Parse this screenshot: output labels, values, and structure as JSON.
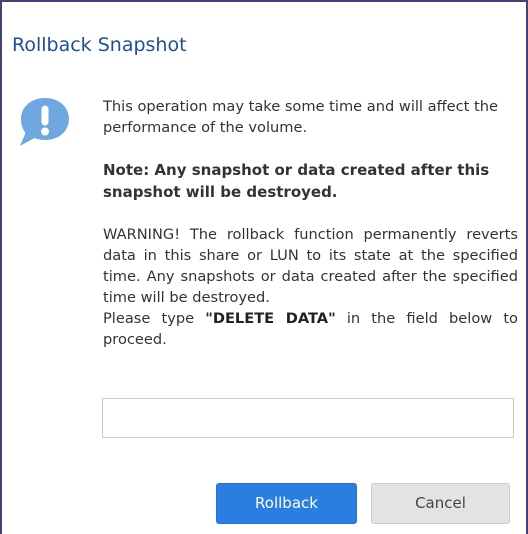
{
  "dialog": {
    "title": "Rollback Snapshot",
    "icon": "info-speech-bubble-icon",
    "message_performance": "This operation may take some time and will affect the performance of the volume.",
    "note": "Note: Any snapshot or data created after this snapshot will be destroyed.",
    "warning": "WARNING! The rollback function permanently reverts data in this share or LUN to its state at the specified time. Any snapshots or data created after the specified time will be destroyed.",
    "instruction_prefix": "Please type ",
    "instruction_keyword": "\"DELETE DATA\"",
    "instruction_suffix": " in the field below to proceed.",
    "confirm_input": {
      "value": "",
      "placeholder": ""
    },
    "buttons": {
      "rollback": "Rollback",
      "cancel": "Cancel"
    }
  },
  "colors": {
    "border": "#4a3f7a",
    "title": "#1f4e99",
    "icon": "#6fa8e0",
    "primary_button": "#2a7de1",
    "secondary_button": "#e3e3e3"
  }
}
